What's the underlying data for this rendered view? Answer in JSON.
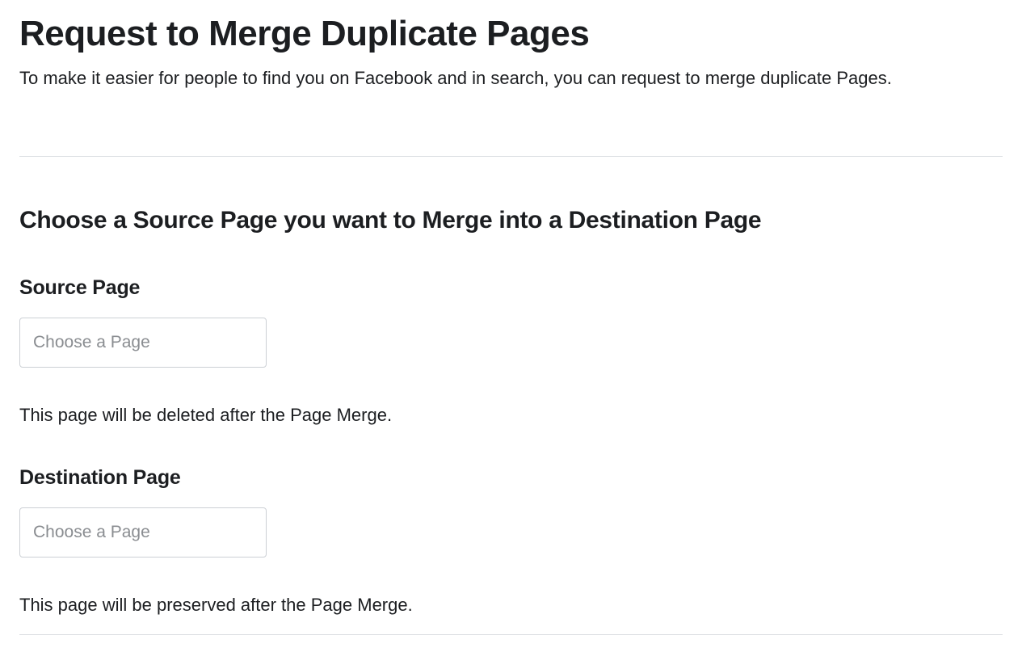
{
  "header": {
    "title": "Request to Merge Duplicate Pages",
    "description": "To make it easier for people to find you on Facebook and in search, you can request to merge duplicate Pages."
  },
  "section": {
    "heading": "Choose a Source Page you want to Merge into a Destination Page"
  },
  "source": {
    "label": "Source Page",
    "placeholder": "Choose a Page",
    "helper": "This page will be deleted after the Page Merge."
  },
  "destination": {
    "label": "Destination Page",
    "placeholder": "Choose a Page",
    "helper": "This page will be preserved after the Page Merge."
  }
}
